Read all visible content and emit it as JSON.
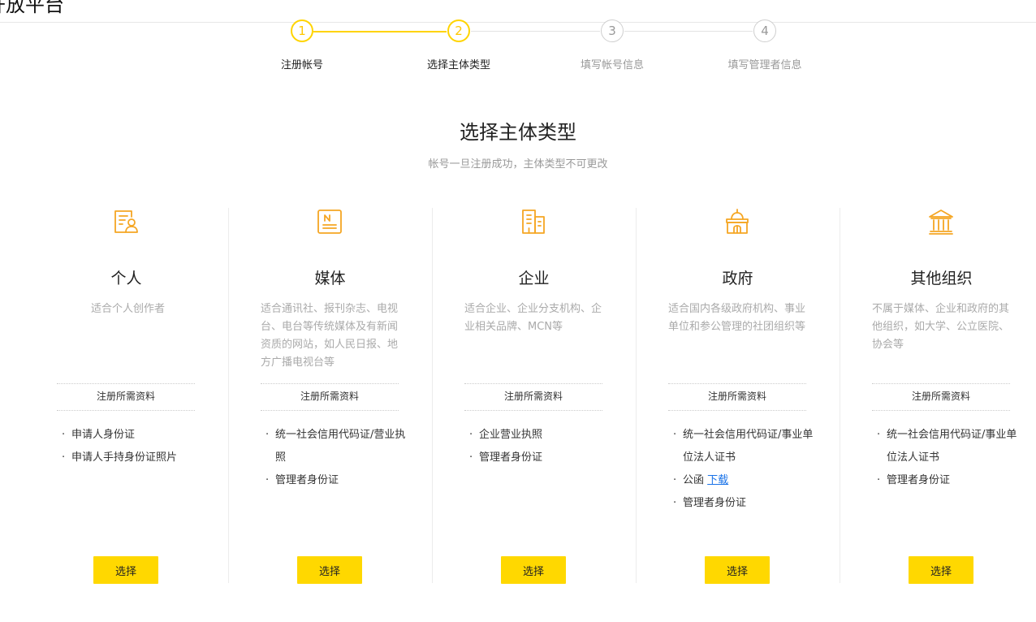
{
  "header": {
    "title": "开放平台"
  },
  "colors": {
    "accent": "#ffd800",
    "link": "#1a73e8",
    "muted": "#999999"
  },
  "steps": [
    {
      "number": "1",
      "label": "注册帐号",
      "state": "active"
    },
    {
      "number": "2",
      "label": "选择主体类型",
      "state": "active"
    },
    {
      "number": "3",
      "label": "填写帐号信息",
      "state": "inactive"
    },
    {
      "number": "4",
      "label": "填写管理者信息",
      "state": "inactive"
    }
  ],
  "section": {
    "title": "选择主体类型",
    "subtitle": "帐号一旦注册成功，主体类型不可更改"
  },
  "requirements_heading": "注册所需资料",
  "select_label": "选择",
  "types": [
    {
      "icon": "personal-id-icon",
      "title": "个人",
      "description": "适合个人创作者",
      "requirements": [
        "申请人身份证",
        "申请人手持身份证照片"
      ]
    },
    {
      "icon": "newspaper-icon",
      "title": "媒体",
      "description": "适合通讯社、报刊杂志、电视台、电台等传统媒体及有新闻资质的网站，如人民日报、地方广播电视台等",
      "requirements": [
        "统一社会信用代码证/营业执照",
        "管理者身份证"
      ]
    },
    {
      "icon": "office-building-icon",
      "title": "企业",
      "description": "适合企业、企业分支机构、企业相关品牌、MCN等",
      "requirements": [
        "企业营业执照",
        "管理者身份证"
      ]
    },
    {
      "icon": "government-building-icon",
      "title": "政府",
      "description": "适合国内各级政府机构、事业单位和参公管理的社团组织等",
      "requirements": [
        "统一社会信用代码证/事业单位法人证书",
        "公函",
        "管理者身份证"
      ],
      "download_label": "下载"
    },
    {
      "icon": "institution-icon",
      "title": "其他组织",
      "description": "不属于媒体、企业和政府的其他组织，如大学、公立医院、协会等",
      "requirements": [
        "统一社会信用代码证/事业单位法人证书",
        "管理者身份证"
      ]
    }
  ]
}
